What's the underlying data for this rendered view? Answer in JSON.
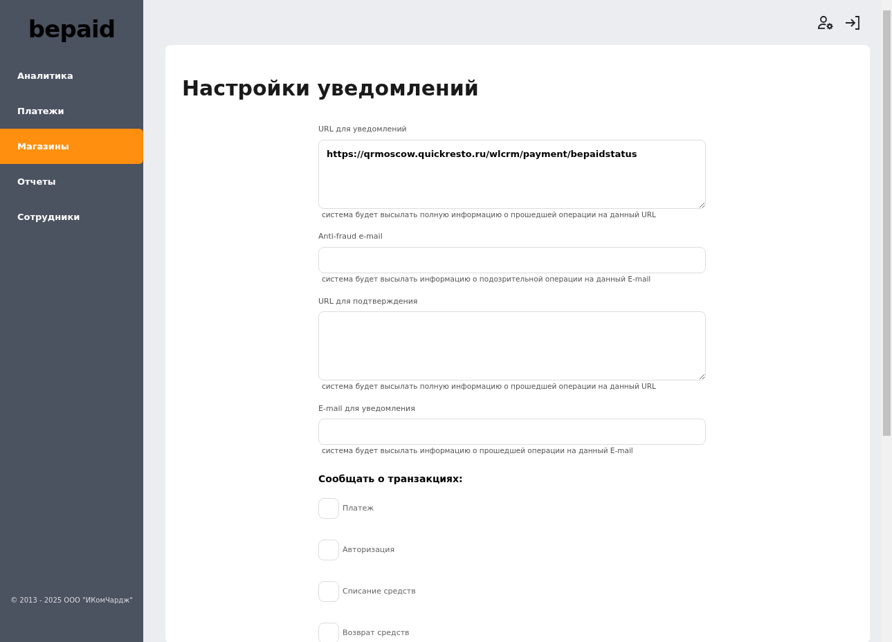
{
  "logo": {
    "text": "bepaid"
  },
  "sidebar": {
    "items": [
      {
        "label": "Аналитика",
        "selected": false
      },
      {
        "label": "Платежи",
        "selected": false
      },
      {
        "label": "Магазины",
        "selected": true
      },
      {
        "label": "Отчеты",
        "selected": false
      },
      {
        "label": "Сотрудники",
        "selected": false
      }
    ],
    "footer": "© 2013 - 2025 ООО \"ИКомЧардж\""
  },
  "page": {
    "title": "Настройки уведомлений"
  },
  "fields": [
    {
      "kind": "textarea",
      "label": "URL для уведомлений",
      "value": "https://qrmoscow.quickresto.ru/wlcrm/payment/bepaidstatus",
      "hint": "система будет высылать полную информацию о прошедшей операции на данный URL"
    },
    {
      "kind": "input",
      "label": "Anti-fraud e-mail",
      "hint": "система будет высылать информацию о подозрительной операции на данный E-mail"
    },
    {
      "kind": "textarea",
      "label": "URL для подтверждения",
      "hint": "система будет высылать полную информацию о прошедшей операции на данный URL"
    },
    {
      "kind": "input",
      "label": "E-mail для уведомления",
      "hint": "система будет высылать информацию о прошедшей операции на данный E-mail"
    }
  ],
  "transactions": {
    "heading": "Сообщать о транзакциях:",
    "options": [
      {
        "label": "Платеж",
        "checked": false
      },
      {
        "label": "Авторизация",
        "checked": false
      },
      {
        "label": "Списание средств",
        "checked": false
      },
      {
        "label": "Возврат средств",
        "checked": false
      }
    ]
  }
}
